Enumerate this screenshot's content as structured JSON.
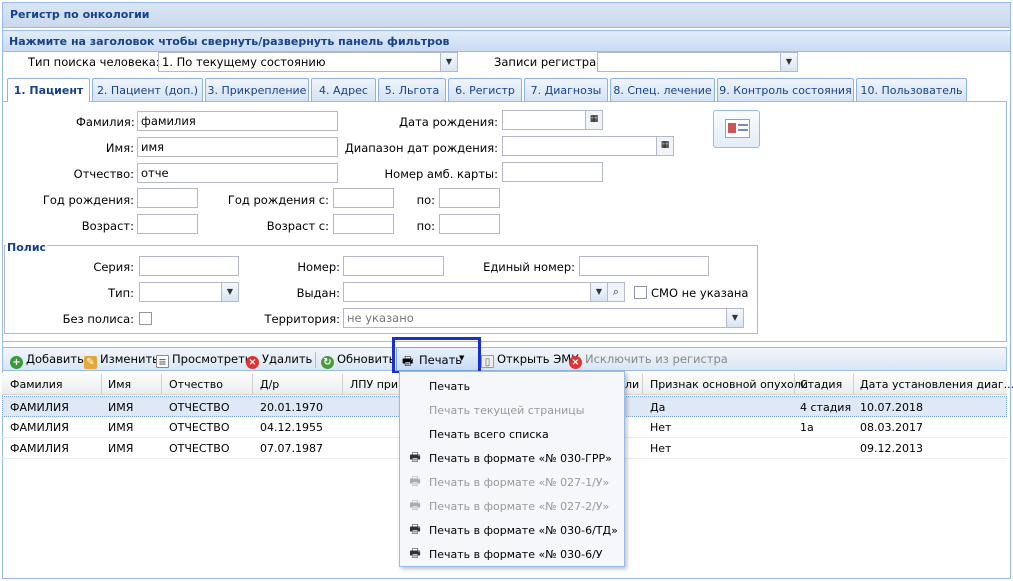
{
  "window": {
    "title": "Регистр по онкологии"
  },
  "filter_header": "Нажмите на заголовок чтобы свернуть/развернуть панель фильтров",
  "search_type": {
    "label": "Тип поиска человека:",
    "value": "1. По текущему состоянию"
  },
  "register_records": {
    "label": "Записи регистра:",
    "value": ""
  },
  "tabs": [
    {
      "label": "1. Пациент"
    },
    {
      "label": "2. Пациент (доп.)"
    },
    {
      "label": "3. Прикрепление"
    },
    {
      "label": "4. Адрес"
    },
    {
      "label": "5. Льгота"
    },
    {
      "label": "6. Регистр"
    },
    {
      "label": "7. Диагнозы"
    },
    {
      "label": "8. Спец. лечение"
    },
    {
      "label": "9. Контроль состояния"
    },
    {
      "label": "10. Пользователь"
    }
  ],
  "form": {
    "surname_label": "Фамилия:",
    "surname_value": "фамилия",
    "name_label": "Имя:",
    "name_value": "имя",
    "patronymic_label": "Отчество:",
    "patronymic_value": "отче",
    "birth_year_label": "Год рождения:",
    "birth_year_from_label": "Год рождения с:",
    "to_label": "по:",
    "age_label": "Возраст:",
    "age_from_label": "Возраст с:",
    "birth_date_label": "Дата рождения:",
    "birth_range_label": "Диапазон дат рождения:",
    "card_number_label": "Номер амб. карты:"
  },
  "polis": {
    "title": "Полис",
    "series_label": "Серия:",
    "number_label": "Номер:",
    "unified_label": "Единый номер:",
    "type_label": "Тип:",
    "issued_label": "Выдан:",
    "smo_label": "СМО не указана",
    "no_polis_label": "Без полиса:",
    "territory_label": "Территория:",
    "territory_value": "не указано"
  },
  "toolbar": {
    "add": "Добавить",
    "edit": "Изменить",
    "view": "Просмотреть",
    "delete": "Удалить",
    "refresh": "Обновить",
    "print": "Печать",
    "open_emk": "Открыть ЭМК",
    "exclude": "Исключить из регистра"
  },
  "grid": {
    "columns": [
      "Фамилия",
      "Имя",
      "Отчество",
      "Д/р",
      "ЛПУ прикр",
      "ли",
      "Признак основной опухоли",
      "Стадия",
      "Дата установления диаг..."
    ],
    "rows": [
      [
        "ФАМИЛИЯ",
        "ИМЯ",
        "ОТЧЕСТВО",
        "20.01.1970",
        "",
        "",
        "Да",
        "4 стадия",
        "10.07.2018"
      ],
      [
        "ФАМИЛИЯ",
        "ИМЯ",
        "ОТЧЕСТВО",
        "04.12.1955",
        "",
        "",
        "Нет",
        "1а",
        "08.03.2017"
      ],
      [
        "ФАМИЛИЯ",
        "ИМЯ",
        "ОТЧЕСТВО",
        "07.07.1987",
        "",
        "",
        "Нет",
        "",
        "09.12.2013"
      ]
    ]
  },
  "print_menu": [
    {
      "label": "Печать",
      "disabled": false,
      "icon": ""
    },
    {
      "label": "Печать текущей страницы",
      "disabled": true,
      "icon": ""
    },
    {
      "label": "Печать всего списка",
      "disabled": false,
      "icon": ""
    },
    {
      "label": "Печать в формате «№ 030-ГРР»",
      "disabled": false,
      "icon": "printer-icon"
    },
    {
      "label": "Печать в формате «№ 027-1/У»",
      "disabled": true,
      "icon": "printer-icon"
    },
    {
      "label": "Печать в формате «№ 027-2/У»",
      "disabled": true,
      "icon": "printer-icon"
    },
    {
      "label": "Печать в формате «№ 030-6/ТД»",
      "disabled": false,
      "icon": "printer-icon"
    },
    {
      "label": "Печать в формате «№ 030-6/У",
      "disabled": false,
      "icon": "printer-icon"
    }
  ]
}
